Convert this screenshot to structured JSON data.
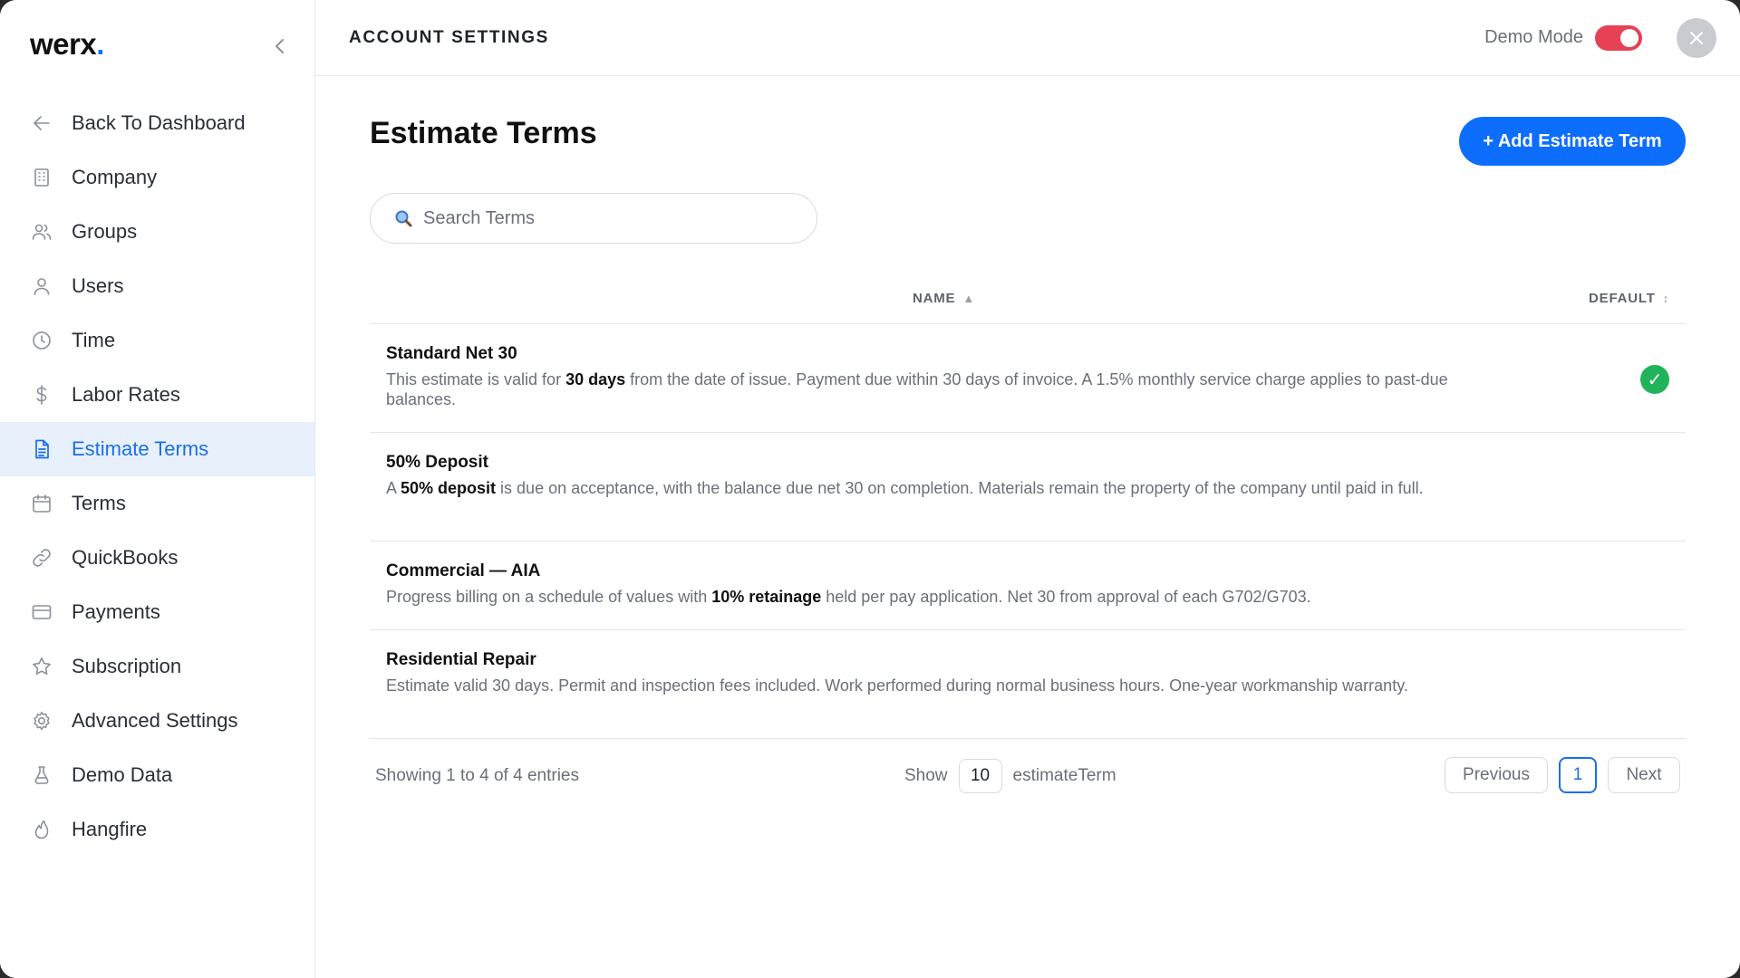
{
  "app": {
    "logo_text": "werx",
    "logo_dot": "."
  },
  "sidebar": {
    "items": [
      {
        "label": "Back To Dashboard",
        "icon": "arrow-left-icon"
      },
      {
        "label": "Company",
        "icon": "building-icon"
      },
      {
        "label": "Groups",
        "icon": "users-icon"
      },
      {
        "label": "Users",
        "icon": "user-icon"
      },
      {
        "label": "Time",
        "icon": "clock-icon"
      },
      {
        "label": "Labor Rates",
        "icon": "dollar-icon"
      },
      {
        "label": "Estimate Terms",
        "icon": "document-icon",
        "active": true
      },
      {
        "label": "Terms",
        "icon": "calendar-icon"
      },
      {
        "label": "QuickBooks",
        "icon": "link-icon"
      },
      {
        "label": "Payments",
        "icon": "credit-card-icon"
      },
      {
        "label": "Subscription",
        "icon": "star-icon"
      },
      {
        "label": "Advanced Settings",
        "icon": "gear-icon"
      },
      {
        "label": "Demo Data",
        "icon": "flask-icon"
      },
      {
        "label": "Hangfire",
        "icon": "flame-icon"
      }
    ]
  },
  "header": {
    "title": "ACCOUNT SETTINGS",
    "demo_mode_label": "Demo Mode",
    "demo_mode_on": true
  },
  "main": {
    "page_title": "Estimate Terms",
    "add_button_label": "+ Add Estimate Term",
    "search_placeholder": "Search Terms",
    "columns": {
      "name": "NAME",
      "default": "DEFAULT"
    },
    "rows": [
      {
        "name": "Standard Net 30",
        "desc_pre": "This estimate is valid for ",
        "desc_bold": "30 days",
        "desc_post": " from the date of issue. Payment due within 30 days of invoice. A 1.5% monthly service charge applies to past-due balances.",
        "default": true
      },
      {
        "name": "50% Deposit",
        "desc_pre": "A ",
        "desc_bold": "50% deposit",
        "desc_post": " is due on acceptance, with the balance due net 30 on completion. Materials remain the property of the company until paid in full.",
        "default": false
      },
      {
        "name": "Commercial — AIA",
        "desc_pre": "Progress billing on a schedule of values with ",
        "desc_bold": "10% retainage",
        "desc_post": " held per pay application. Net 30 from approval of each G702/G703.",
        "default": false
      },
      {
        "name": "Residential Repair",
        "desc_pre": "Estimate valid 30 days. Permit and inspection fees included. Work performed during normal business hours. One-year workmanship warranty.",
        "desc_bold": "",
        "desc_post": "",
        "default": false
      }
    ],
    "footer": {
      "entries_text": "Showing 1 to 4 of 4 entries",
      "show_label": "Show",
      "page_size": "10",
      "page_size_suffix": "estimateTerm",
      "prev_label": "Previous",
      "current_page": "1",
      "next_label": "Next"
    }
  },
  "colors": {
    "accent": "#0d6efd",
    "active_nav_bg": "#e8f0fb",
    "toggle_on": "#e64155",
    "check_green": "#21b35a"
  }
}
